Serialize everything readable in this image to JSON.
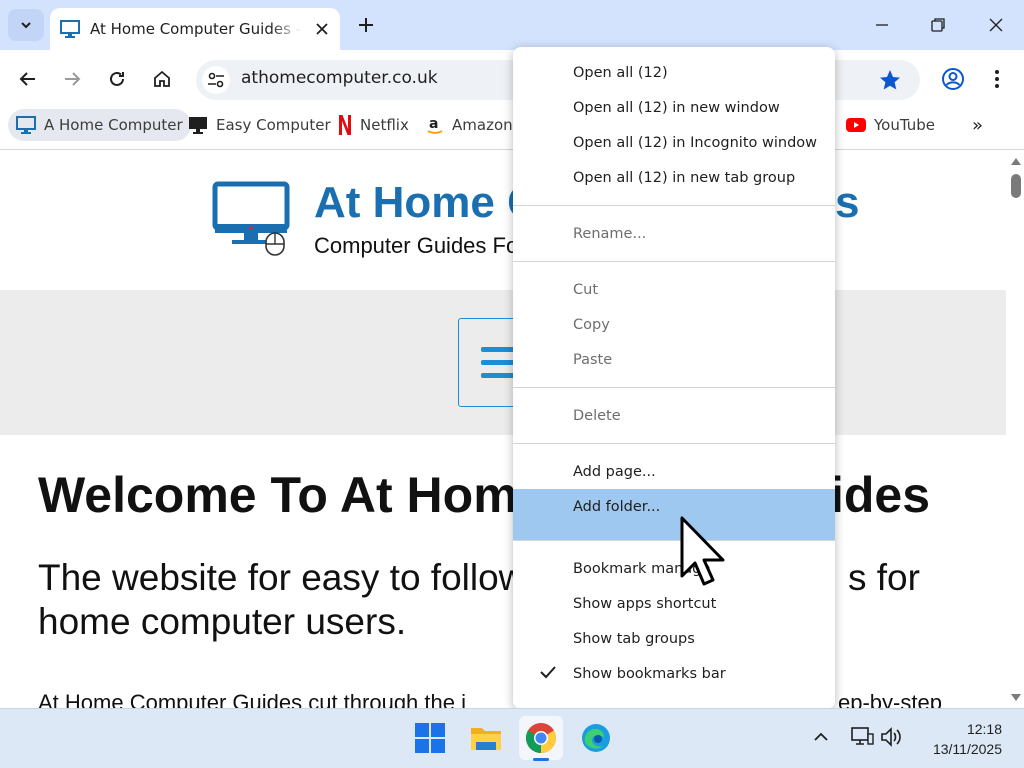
{
  "browser": {
    "tab": {
      "title": "At Home Computer Guides - Computer Guides For Home Users"
    },
    "address": {
      "url": "athomecomputer.co.uk"
    },
    "bookmarks": [
      {
        "label": "A Home Computer",
        "icon": "monitor-icon"
      },
      {
        "label": "Easy Computer",
        "icon": "monitor-black-icon"
      },
      {
        "label": "Netflix",
        "icon": "netflix-icon"
      },
      {
        "label": "Amazon",
        "icon": "amazon-icon"
      },
      {
        "label": "YouTube",
        "icon": "youtube-icon"
      }
    ],
    "overflow_glyph": "»"
  },
  "page": {
    "site_title": "At Home C",
    "site_title_tail": "s",
    "site_subtitle": "Computer Guides Fo",
    "heading_left": "Welcome To At Home",
    "heading_right": "ides",
    "lead_left_1": "The website for easy to follow",
    "lead_right_1": "s for",
    "lead_line_2": "home computer users.",
    "para_left": "At Home Computer Guides cut through the j",
    "para_right": "ep-by-step"
  },
  "context_menu": {
    "groups": [
      [
        {
          "label": "Open all (12)",
          "disabled": false
        },
        {
          "label": "Open all (12) in new window",
          "disabled": false
        },
        {
          "label": "Open all (12) in Incognito window",
          "disabled": false
        },
        {
          "label": "Open all (12) in new tab group",
          "disabled": false
        }
      ],
      [
        {
          "label": "Rename...",
          "disabled": true
        }
      ],
      [
        {
          "label": "Cut",
          "disabled": true
        },
        {
          "label": "Copy",
          "disabled": true
        },
        {
          "label": "Paste",
          "disabled": true
        }
      ],
      [
        {
          "label": "Delete",
          "disabled": true
        }
      ],
      [
        {
          "label": "Add page...",
          "disabled": false
        },
        {
          "label": "Add folder...",
          "disabled": false,
          "highlighted": true
        }
      ],
      [
        {
          "label": "Bookmark manage",
          "disabled": false
        },
        {
          "label": "Show apps shortcut",
          "disabled": false
        },
        {
          "label": "Show tab groups",
          "disabled": false
        },
        {
          "label": "Show bookmarks bar",
          "disabled": false,
          "checked": true
        }
      ]
    ]
  },
  "taskbar": {
    "apps": [
      "windows-start-icon",
      "file-explorer-icon",
      "chrome-icon",
      "edge-icon"
    ],
    "time": "12:18",
    "date": "13/11/2025"
  },
  "colors": {
    "accent": "#1a6fb0",
    "tabstrip": "#d3e3fd",
    "highlight": "#9ec8ef"
  }
}
